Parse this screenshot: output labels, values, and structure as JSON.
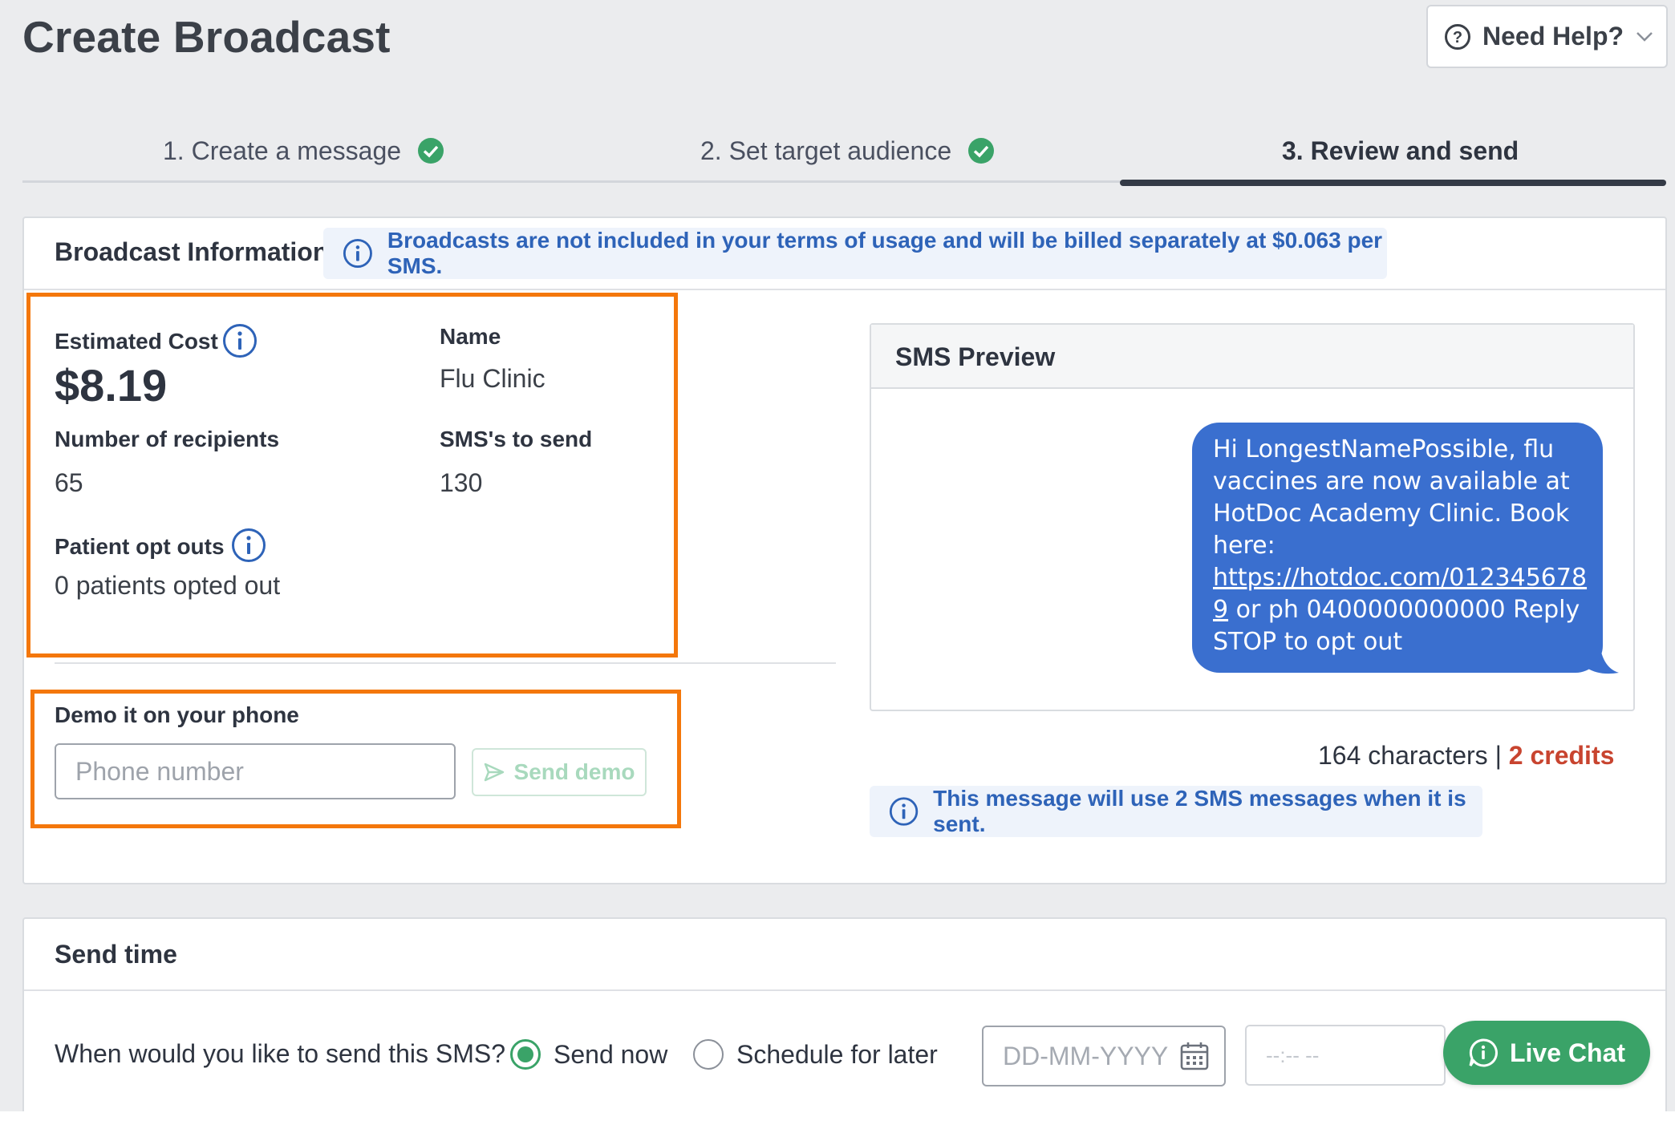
{
  "header": {
    "title": "Create Broadcast",
    "help_label": "Need Help?"
  },
  "steps": [
    {
      "label": "1. Create a message",
      "state": "complete"
    },
    {
      "label": "2. Set target audience",
      "state": "complete"
    },
    {
      "label": "3. Review and send",
      "state": "active"
    }
  ],
  "broadcast_info": {
    "title": "Broadcast Information",
    "banner": "Broadcasts are not included in your terms of usage and will be billed separately at $0.063 per SMS.",
    "estimated_cost_label": "Estimated Cost",
    "estimated_cost_value": "$8.19",
    "name_label": "Name",
    "name_value": "Flu Clinic",
    "recipients_label": "Number of recipients",
    "recipients_value": "65",
    "sms_label": "SMS's to send",
    "sms_value": "130",
    "optouts_label": "Patient opt outs",
    "optouts_value": "0 patients opted out"
  },
  "demo": {
    "title": "Demo it on your phone",
    "phone_placeholder": "Phone number",
    "send_label": "Send demo"
  },
  "sms_preview": {
    "title": "SMS Preview",
    "message_before_link": "Hi LongestNamePossible, flu vaccines are now available at HotDoc Academy Clinic. Book here: ",
    "link_line1": "https://hotdoc.com/012345678",
    "link_line2": "9",
    "message_after_link": " or ph 0400000000000 Reply STOP to opt out",
    "characters": "164 characters",
    "separator": "|",
    "credits": "2 credits",
    "usage_banner": "This message will use 2 SMS messages when it is sent."
  },
  "send_time": {
    "title": "Send time",
    "question": "When would you like to send this SMS?",
    "option_now": "Send now",
    "option_later": "Schedule for later",
    "selected": "Send now",
    "date_placeholder": "DD-MM-YYYY",
    "time_placeholder": "--:-- --"
  },
  "live_chat": {
    "label": "Live Chat"
  },
  "colors": {
    "accent_blue": "#2e63b8",
    "success_green": "#3aa368",
    "highlight_orange": "#f4770b",
    "bubble_blue": "#3a6fcf",
    "credits_red": "#c8442f"
  },
  "icons": {
    "help": "question-circle-icon",
    "complete": "check-circle-icon",
    "info": "info-circle-icon",
    "send": "paper-plane-icon",
    "calendar": "calendar-icon",
    "chat": "chat-bubble-icon"
  }
}
